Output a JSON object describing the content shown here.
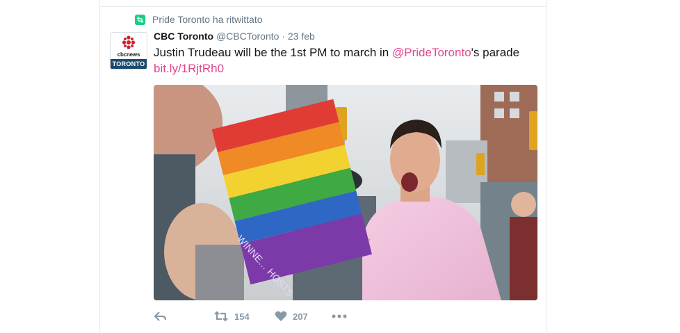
{
  "context": {
    "label": "Pride Toronto ha ritwittato"
  },
  "tweet": {
    "author_name": "CBC Toronto",
    "author_handle": "@CBCToronto",
    "separator": "·",
    "time": "23 feb",
    "avatar": {
      "brand": "cbcnews",
      "city": "TORONTO"
    },
    "text_before": "Justin Trudeau will be the 1st PM to march in ",
    "mention": "@PrideToronto",
    "text_after": "'s parade",
    "link": "bit.ly/1RjtRh0",
    "flag_text": "WINNE… HOSTS"
  },
  "actions": {
    "retweet_count": "154",
    "like_count": "207"
  },
  "colors": {
    "link": "#e0468e",
    "retweet_badge": "#19cf86",
    "meta": "#657786",
    "action": "#8899a6"
  }
}
